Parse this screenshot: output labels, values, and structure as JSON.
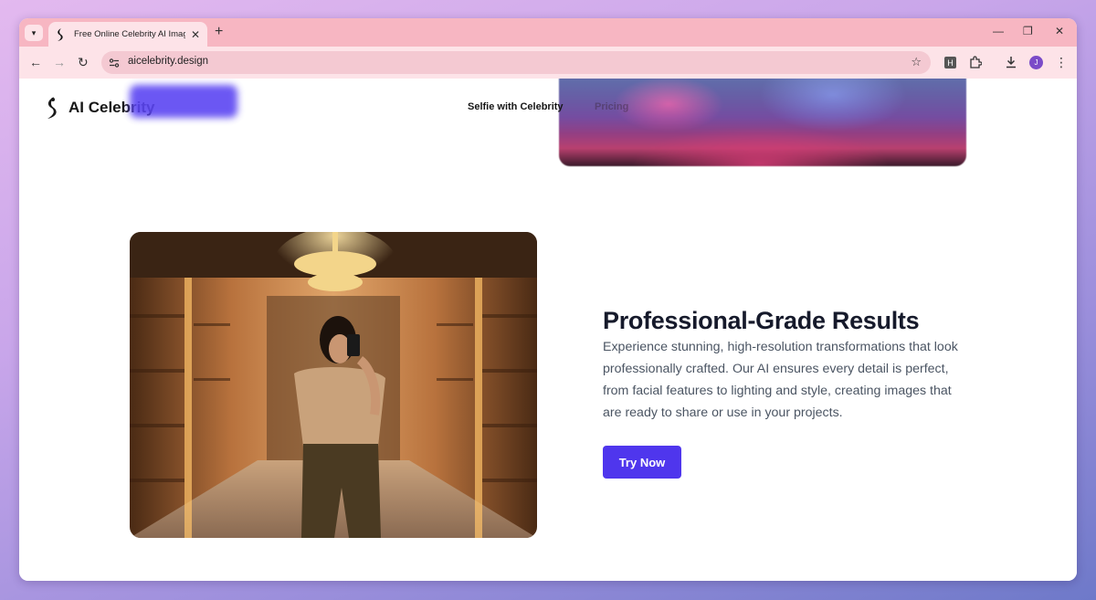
{
  "browser": {
    "tab_title": "Free Online Celebrity AI Image Gene",
    "tab_close": "✕",
    "new_tab": "+",
    "url": "aicelebrity.design",
    "profile_initial": "J",
    "extension_letter": "H",
    "controls": {
      "minimize": "—",
      "restore": "❐",
      "close": "✕"
    }
  },
  "site": {
    "name": "AI Celebrity",
    "nav": [
      "Selfie with Celebrity",
      "Pricing"
    ]
  },
  "feature": {
    "title": "Professional-Grade Results",
    "description": "Experience stunning, high-resolution transformations that look professionally crafted. Our AI ensures every detail is perfect, from facial features to lighting and style, creating images that are ready to share or use in your projects.",
    "cta": "Try Now"
  },
  "colors": {
    "accent": "#4f36ed",
    "tab_strip": "#f7b6c2",
    "toolbar": "#fde3e8"
  }
}
